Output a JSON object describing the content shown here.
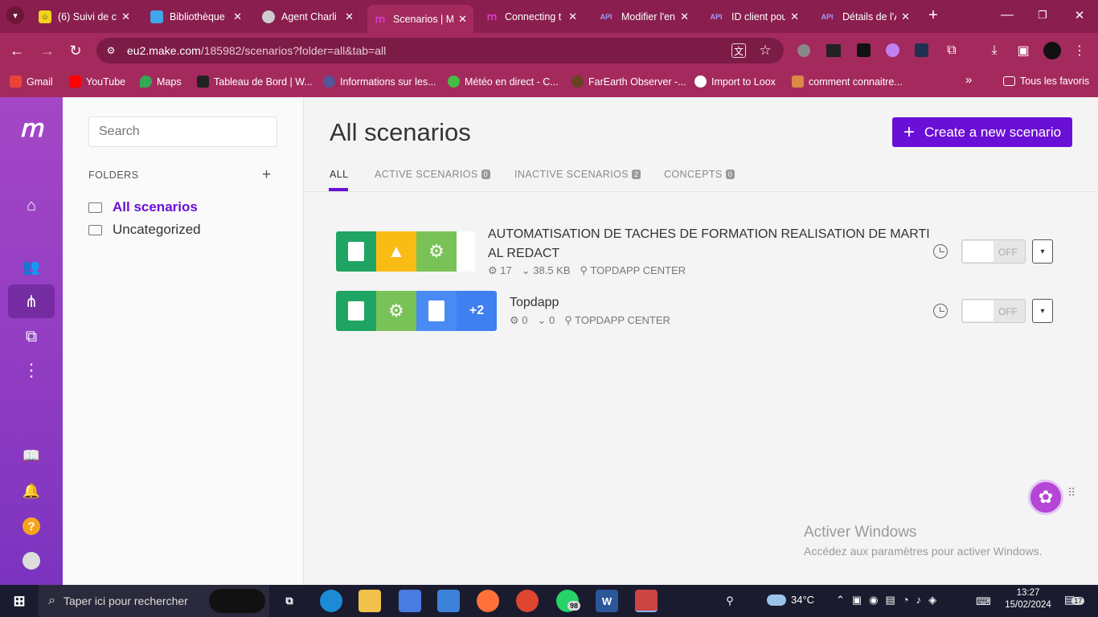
{
  "browser": {
    "tabs": [
      {
        "title": "(6) Suivi de c",
        "icon": "face-icon",
        "color": "#f0d21c"
      },
      {
        "title": "Bibliothèque",
        "icon": "cloud-icon",
        "color": "#3fa6e8"
      },
      {
        "title": "Agent Charli",
        "icon": "agent-icon",
        "color": "#cccccc"
      },
      {
        "title": "Scenarios | M",
        "icon": "make-icon",
        "color": "#d93bd6"
      },
      {
        "title": "Connecting t",
        "icon": "make-icon",
        "color": "#d93bd6"
      },
      {
        "title": "Modifier l'en",
        "icon": "api-icon",
        "color": "#9c9cff"
      },
      {
        "title": "ID client pou",
        "icon": "api-icon",
        "color": "#9c9cff"
      },
      {
        "title": "Détails de l'A",
        "icon": "api-icon",
        "color": "#9c9cff"
      }
    ],
    "tab_close": "✕",
    "new_tab": "+",
    "url_host": "eu2.make.com",
    "url_path": "/185982/scenarios?folder=all&tab=all",
    "bookmarks": [
      {
        "label": "Gmail",
        "color": "#ea4335"
      },
      {
        "label": "YouTube",
        "color": "#ff0000"
      },
      {
        "label": "Maps",
        "color": "#34a853"
      },
      {
        "label": "Tableau de Bord | W...",
        "color": "#222222"
      },
      {
        "label": "Informations sur les...",
        "color": "#555599"
      },
      {
        "label": "Météo en direct - C...",
        "color": "#44bb44"
      },
      {
        "label": "FarEarth Observer -...",
        "color": "#664422"
      },
      {
        "label": "Import to Loox",
        "color": "#ffffff"
      },
      {
        "label": "comment connaitre...",
        "color": "#dd8844"
      }
    ],
    "bookmarks_more": "»",
    "all_bookmarks": "Tous les favoris"
  },
  "app": {
    "accent": "#6a0fd6",
    "search_placeholder": "Search",
    "folders_heading": "FOLDERS",
    "add_folder": "+",
    "folders": [
      "All scenarios",
      "Uncategorized"
    ],
    "page_title": "All scenarios",
    "create_label": "Create a new scenario",
    "create_plus": "+",
    "tabs": [
      {
        "label": "ALL",
        "count": null
      },
      {
        "label": "ACTIVE SCENARIOS",
        "count": "0"
      },
      {
        "label": "INACTIVE SCENARIOS",
        "count": "2"
      },
      {
        "label": "CONCEPTS",
        "count": "0"
      }
    ],
    "scenarios": [
      {
        "name": "AUTOMATISATION DE TACHES DE FORMATION REALISATION DE MARTI AL REDACT",
        "name_line1": "AUTOMATISATION DE TACHES DE FORMATION REALISATION DE MARTI",
        "name_line2": "AL REDACT",
        "ops": "17",
        "size": "38.5 KB",
        "owner": "TOPDAPP CENTER",
        "apps": [
          "google-sheets-icon",
          "google-drive-icon",
          "tools-gear-icon"
        ],
        "status": "OFF"
      },
      {
        "name": "Topdapp",
        "ops": "0",
        "size": "0",
        "owner": "TOPDAPP CENTER",
        "apps": [
          "google-sheets-icon",
          "tools-gear-icon",
          "google-docs-icon"
        ],
        "more": "+2",
        "status": "OFF"
      }
    ]
  },
  "windows": {
    "activate_title": "Activer Windows",
    "activate_sub": "Accédez aux paramètres pour activer Windows.",
    "search_placeholder": "Taper ici pour rechercher",
    "weather": "34°C",
    "time": "13:27",
    "date": "15/02/2024",
    "whatsapp_badge": "98",
    "notif_badge": "17"
  }
}
